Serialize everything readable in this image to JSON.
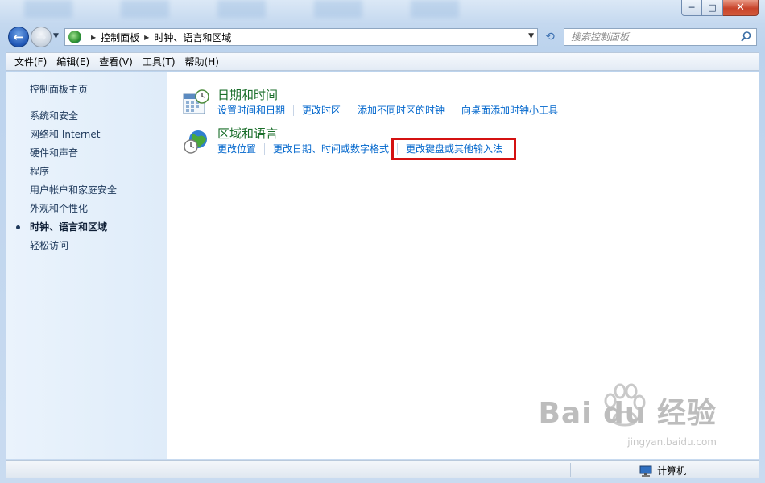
{
  "window": {
    "minimize_label": "─",
    "maximize_label": "□",
    "close_label": "✕"
  },
  "nav": {
    "back_glyph": "←",
    "forward_glyph": "→",
    "breadcrumb": [
      "控制面板",
      "时钟、语言和区域"
    ],
    "search_placeholder": "搜索控制面板",
    "refresh_glyph": "⟲"
  },
  "menubar": {
    "items": [
      "文件(F)",
      "编辑(E)",
      "查看(V)",
      "工具(T)",
      "帮助(H)"
    ]
  },
  "sidebar": {
    "items": [
      {
        "label": "控制面板主页"
      },
      {
        "label": "系统和安全"
      },
      {
        "label": "网络和 Internet"
      },
      {
        "label": "硬件和声音"
      },
      {
        "label": "程序"
      },
      {
        "label": "用户帐户和家庭安全"
      },
      {
        "label": "外观和个性化"
      },
      {
        "label": "时钟、语言和区域",
        "current": true
      },
      {
        "label": "轻松访问"
      }
    ]
  },
  "main": {
    "categories": [
      {
        "title": "日期和时间",
        "icon": "calendar-clock-icon",
        "links": [
          "设置时间和日期",
          "更改时区",
          "添加不同时区的时钟",
          "向桌面添加时钟小工具"
        ]
      },
      {
        "title": "区域和语言",
        "icon": "globe-clock-icon",
        "links": [
          "更改位置",
          "更改日期、时间或数字格式",
          "更改键盘或其他输入法"
        ]
      }
    ],
    "highlight_color": "#d41111"
  },
  "watermark": {
    "brand": "Bai du 经验",
    "sub": "jingyan.baidu.com"
  },
  "statusbar": {
    "computer_label": "计算机"
  }
}
